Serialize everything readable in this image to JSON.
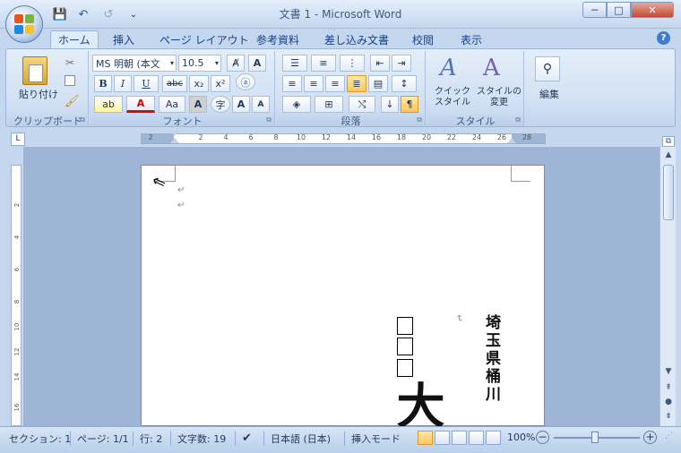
{
  "window": {
    "title": "文書 1 - Microsoft Word",
    "minimize": "─",
    "maximize": "□",
    "close": "✕"
  },
  "qat": {
    "save": "💾",
    "undo": "↶",
    "redo": "↺",
    "dropdown": "⌄"
  },
  "tabs": [
    {
      "label": "ホーム",
      "active": true
    },
    {
      "label": "挿入"
    },
    {
      "label": "ページ レイアウト"
    },
    {
      "label": "参考資料"
    },
    {
      "label": "差し込み文書"
    },
    {
      "label": "校閲"
    },
    {
      "label": "表示"
    }
  ],
  "help_icon": "?",
  "ribbon": {
    "clipboard": {
      "label": "クリップボード",
      "paste": "貼り付け"
    },
    "font": {
      "label": "フォント",
      "font_name": "MS 明朝 (本文",
      "font_size": "10.5",
      "bold": "B",
      "italic": "I",
      "underline": "U",
      "strike": "abc",
      "sub": "x₂",
      "sup": "x²",
      "grow": "A",
      "shrink": "A",
      "aa": "Aa",
      "char_border": "A",
      "enclose": "字"
    },
    "paragraph": {
      "label": "段落"
    },
    "styles": {
      "label": "スタイル",
      "quick": "クイック\nスタイル",
      "change": "スタイルの\n変更"
    },
    "editing": {
      "label": "編集"
    }
  },
  "ruler": {
    "ticks": [
      "2",
      "2",
      "4",
      "6",
      "8",
      "10",
      "12",
      "14",
      "16",
      "18",
      "20",
      "22",
      "24",
      "26",
      "28"
    ]
  },
  "vruler": {
    "ticks": [
      "2",
      "4",
      "6",
      "8",
      "10",
      "12",
      "14",
      "16"
    ]
  },
  "document": {
    "address": "埼玉県桶川",
    "name_char": "大"
  },
  "status": {
    "section": "セクション: 1",
    "page": "ページ: 1/1",
    "line": "行: 2",
    "chars": "文字数: 19",
    "language": "日本語 (日本)",
    "mode": "挿入モード",
    "zoom": "100%"
  },
  "colors": {
    "accent": "#15428b",
    "ribbon": "#dbe7f6",
    "status": "#c6d8ef"
  }
}
